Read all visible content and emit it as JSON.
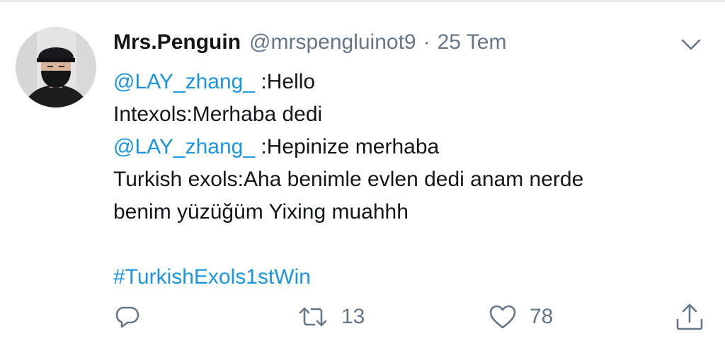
{
  "tweet": {
    "display_name": "Mrs.Penguin",
    "handle": "@mrspengluinot9",
    "separator": "·",
    "date": "25 Tem",
    "lines": [
      {
        "mention": "@LAY_zhang_",
        "text": " :Hello"
      },
      {
        "text": "Intexols:Merhaba dedi"
      },
      {
        "mention": "@LAY_zhang_",
        "text": " :Hepinize merhaba"
      },
      {
        "text": "Turkish exols:Aha benimle evlen dedi anam nerde"
      },
      {
        "text": "benim yüzüğüm Yixing muahhh"
      }
    ],
    "hashtag": "#TurkishExols1stWin"
  },
  "actions": {
    "reply_icon": "reply-icon",
    "retweet_icon": "retweet-icon",
    "retweet_count": "13",
    "like_icon": "heart-icon",
    "like_count": "78",
    "share_icon": "share-icon"
  },
  "colors": {
    "link": "#1b95e0",
    "secondary_text": "#657786",
    "primary_text": "#14171a"
  }
}
